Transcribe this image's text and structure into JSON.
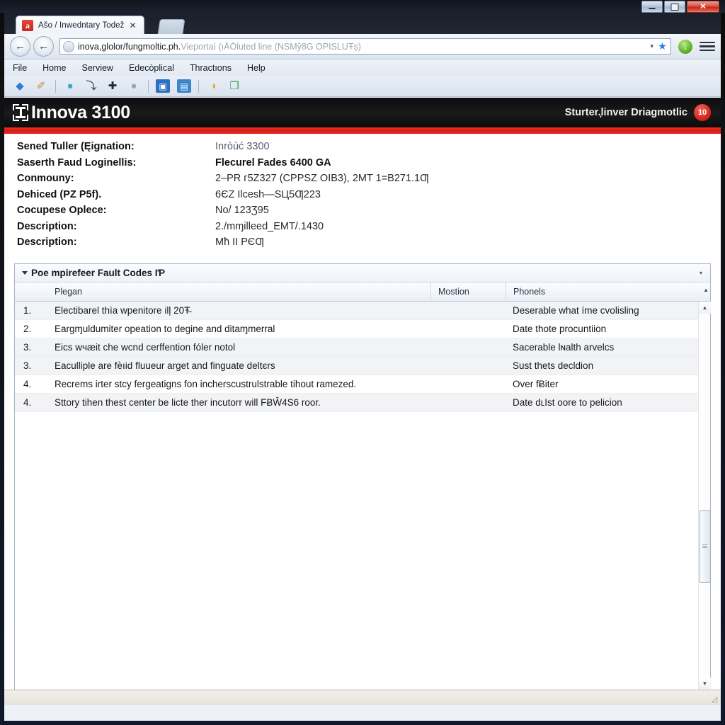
{
  "window": {
    "controls": {
      "minimize": "minimize-button",
      "maximize": "maximize-button",
      "close_label": "✕"
    }
  },
  "browser": {
    "tab": {
      "favicon": "a-logo-icon",
      "title": "Ašo / Inwedntary Todež",
      "close_label": "✕"
    },
    "new_tab_label": "",
    "nav": {
      "back_label": "←",
      "forward_label": "←",
      "url_text": "inova,glolor/fungmoltic.ph.",
      "url_text_dim": "Vieportaì (ıÄÒluted line (NSMŷ8G OPISLUŦș)",
      "url_dropdown_label": "▾",
      "bookmark_label": "★",
      "sync_label": "↓"
    },
    "menus": [
      {
        "label": "File"
      },
      {
        "label": "Home"
      },
      {
        "label": "Serview"
      },
      {
        "label": "Edecòplical"
      },
      {
        "label": "Thractıons"
      },
      {
        "label": "Help"
      }
    ],
    "toolbar_icons": [
      {
        "name": "back-arrow-icon",
        "glyph": "◆",
        "color": "#2b7fd0"
      },
      {
        "name": "wrench-icon",
        "glyph": "✐",
        "color": "#c98a3a"
      },
      {
        "name": "browser-globe-icon",
        "glyph": "●",
        "color": "#3aa7c8"
      },
      {
        "name": "undo-arrow-icon",
        "glyph": "⤵",
        "color": "#1d2a36"
      },
      {
        "name": "cross-icon",
        "glyph": "✚",
        "color": "#1d2a36"
      },
      {
        "name": "disc-icon",
        "glyph": "●",
        "color": "#9aa6b2"
      },
      {
        "name": "blue-window-icon",
        "glyph": "▣",
        "color": "#2b6fc0"
      },
      {
        "name": "blue-page-icon",
        "glyph": "▤",
        "color": "#3c86c9"
      },
      {
        "name": "folder-icon",
        "glyph": "◑",
        "color": "#e0aa35"
      },
      {
        "name": "export-icon",
        "glyph": "❐",
        "color": "#3d9b4e"
      }
    ]
  },
  "page": {
    "brand": {
      "logo": "innova-bracket-logo-icon",
      "name": "Innova 3100",
      "tagline": "Sturter.̦linver Driagmotlic",
      "badge": "10"
    },
    "info_rows": [
      {
        "label": "Sened Tuller (Ęignation:",
        "value": "Inròùć 3300",
        "style": "faint"
      },
      {
        "label": "Saserth Faud Loginellis:",
        "value": "Flecurel Fades 6400 GA",
        "style": "bold"
      },
      {
        "label": "Conmouny:",
        "value": "2–PR г5Z327 (CPPSZ OIB3), 2MT 1=B271.1Ƣ",
        "style": ""
      },
      {
        "label": "Dehiced (PZ P5f).",
        "value": "6ЄZ Іlcesh—SЦ5Ƣ223",
        "style": ""
      },
      {
        "label": "Cocupese Oplece:",
        "value": "No/ 123Ʒ95",
        "style": ""
      },
      {
        "label": "Description:",
        "value": "2./mɱilleed_EMT/.1430",
        "style": ""
      },
      {
        "label": "Description:",
        "value": "Mħ II PЄƢ",
        "style": ""
      }
    ],
    "grid": {
      "group_title": "Poe mpirefeer Fault Codes IƤ",
      "group_caret": "▾",
      "collapse_arrow": "▾",
      "columns": [
        {
          "key": "num",
          "label": ""
        },
        {
          "key": "desc",
          "label": "Plegan"
        },
        {
          "key": "mid",
          "label": "Mostion"
        },
        {
          "key": "last",
          "label": "Phonels"
        }
      ],
      "rows": [
        {
          "num": "1.",
          "desc": "Electibarel thìa ᴡpenitore ilļ 20Ŧ̵",
          "mid": "",
          "last": "Deserable what íme cvolisling"
        },
        {
          "num": "2.",
          "desc": "Eargɱuldumiter opeation to degine and ditaɱmerral",
          "mid": "",
          "last": "Date thote procuntiion"
        },
        {
          "num": "3.",
          "desc": "Eics wчæit che wсnd cerffention fóler notol",
          "mid": "",
          "last": "Sacerable lɴalth arvelcs"
        },
        {
          "num": "3.",
          "desc": "Eaculliple are fѐıid fluueur arget and finguate deltєrs",
          "mid": "",
          "last": "Sust thets decldion"
        },
        {
          "num": "4.",
          "desc": "Recrems irter stcy fergeatigns fon incherscustrulstrable tihout ramezed.",
          "mid": "",
          "last": "Over fɃiter"
        },
        {
          "num": "4.",
          "desc": "Sttory tihen thest center be licte ther incutorr will FɃŴ4S6 roor.",
          "mid": "",
          "last": "Date dʟIst oore to pelicion"
        }
      ],
      "scrollbar": {
        "up_arrow": "▲",
        "down_arrow": "▼"
      }
    }
  },
  "colors": {
    "brand_red": "#e0241c",
    "brand_black": "#121212",
    "accent_blue": "#2b7fd0",
    "row_alt": "#f2f3f5"
  }
}
